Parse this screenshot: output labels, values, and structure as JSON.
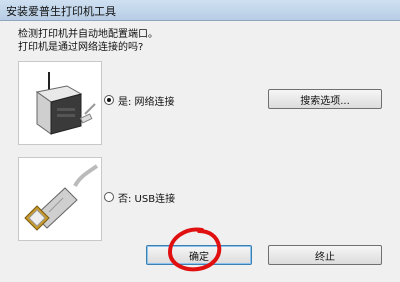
{
  "window": {
    "title": "安装爱普生打印机工具"
  },
  "dialog": {
    "line1": "检测打印机并自动地配置端口。",
    "line2": "打印机是通过网络连接的吗?"
  },
  "options": [
    {
      "label": "是: 网络连接",
      "checked": true,
      "illustration": "network-router-icon"
    },
    {
      "label": "否: USB连接",
      "checked": false,
      "illustration": "usb-plug-icon"
    }
  ],
  "buttons": {
    "search": "搜索选项...",
    "ok": "确定",
    "cancel": "终止"
  },
  "colors": {
    "annotation": "#e01010"
  }
}
